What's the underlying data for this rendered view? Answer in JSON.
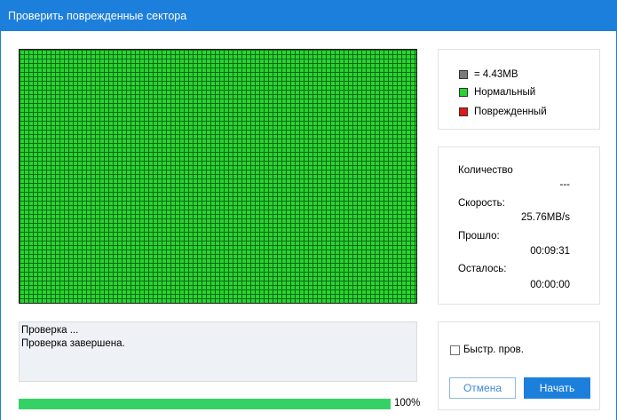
{
  "window": {
    "title": "Проверить поврежденные сектора"
  },
  "legend": {
    "items": [
      {
        "label": "= 4.43MB",
        "color": "#7a7a7a"
      },
      {
        "label": "Нормальный",
        "color": "#28d42f"
      },
      {
        "label": "Поврежденный",
        "color": "#e01818"
      }
    ]
  },
  "stats": {
    "count_label": "Количество",
    "count_value": "---",
    "speed_label": "Скорость:",
    "speed_value": "25.76MB/s",
    "elapsed_label": "Прошло:",
    "elapsed_value": "00:09:31",
    "remaining_label": "Осталось:",
    "remaining_value": "00:00:00"
  },
  "log": {
    "lines": [
      "Проверка ...",
      "Проверка завершена."
    ]
  },
  "progress": {
    "value": 1.0,
    "label": "100%"
  },
  "controls": {
    "quick_check_label": "Быстр. пров.",
    "quick_check_checked": false,
    "cancel_label": "Отмена",
    "start_label": "Начать"
  },
  "colors": {
    "accent": "#1d7fdc",
    "normal": "#28d42f",
    "bad": "#e01818",
    "progress": "#36d164"
  }
}
